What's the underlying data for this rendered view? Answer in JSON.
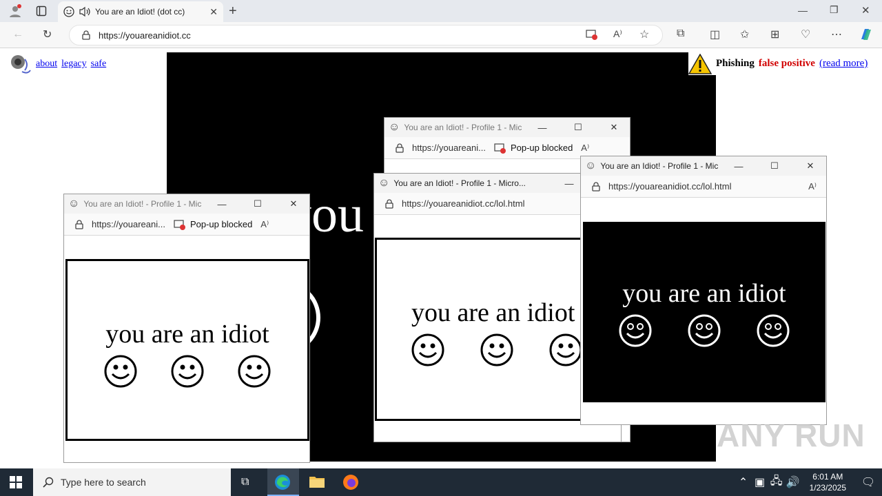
{
  "browser": {
    "tab_title": "You are an Idiot! (dot cc)",
    "url": "https://youareanidiot.cc"
  },
  "page": {
    "links": [
      "about",
      "legacy",
      "safe"
    ],
    "phishing_notice": {
      "word1": "Phishing",
      "word2": "false positive",
      "link": "(read more)"
    },
    "background_text": "you a"
  },
  "popups": [
    {
      "title": "You are an Idiot! - Profile 1 - Micro...",
      "url": "https://youareani...",
      "blocked_label": "Pop-up blocked",
      "content_text": "you are an idiot",
      "theme": "white"
    },
    {
      "title": "You are an Idiot! - Profile 1 - Micro...",
      "url": "https://youareani...",
      "blocked_label": "Pop-up blocked"
    },
    {
      "title": "You are an Idiot! - Profile 1 - Micro...",
      "url": "https://youareanidiot.cc/lol.html",
      "content_text": "you are an idiot",
      "theme": "white"
    },
    {
      "title": "You are an Idiot! - Profile 1 - Micro...",
      "url": "https://youareanidiot.cc/lol.html",
      "content_text": "you are an idiot",
      "theme": "black"
    }
  ],
  "taskbar": {
    "search_placeholder": "Type here to search",
    "time": "6:01 AM",
    "date": "1/23/2025"
  },
  "watermark": "ANY RUN",
  "colors": {
    "phishing_red": "#d10000",
    "link_blue": "#0000ee",
    "taskbar": "#1f2a36"
  }
}
